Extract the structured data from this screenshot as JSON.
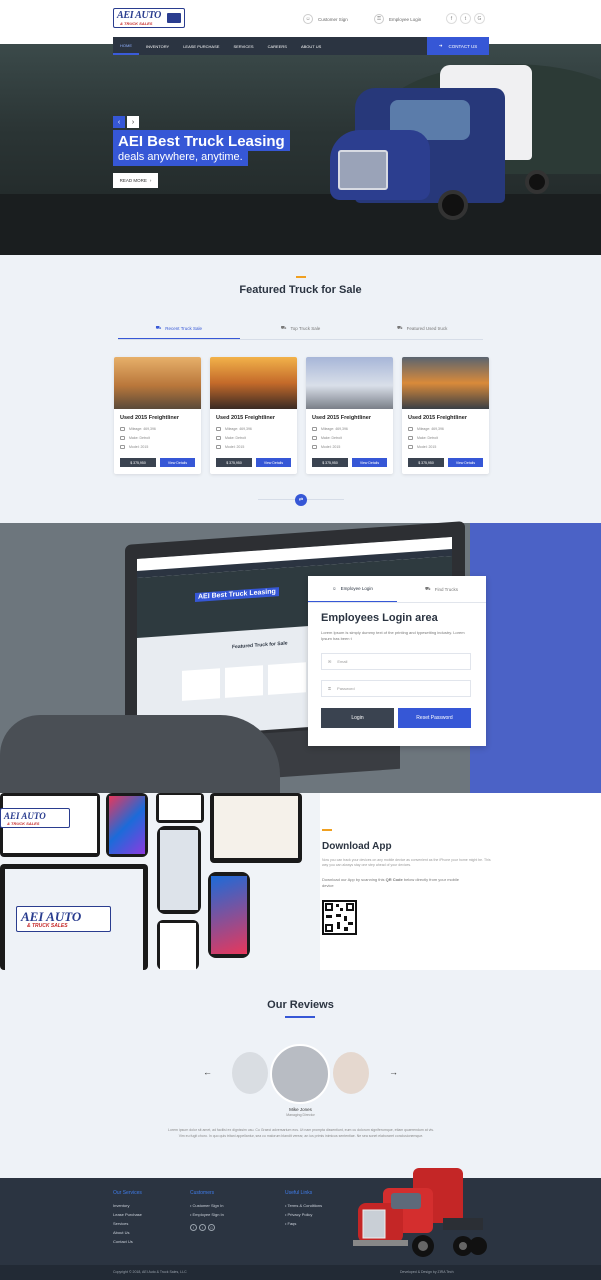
{
  "header": {
    "brand_line1": "AEI AUTO",
    "brand_line2": "& TRUCK SALES",
    "customer_signin": "Customer Sign",
    "employee_login": "Employee Login",
    "social": [
      "f",
      "t",
      "G"
    ]
  },
  "nav": {
    "items": [
      "HOME",
      "INVENTORY",
      "LEASE PURCHASE",
      "SERVICES",
      "CAREERS",
      "ABOUT US"
    ],
    "contact": "CONTACT US"
  },
  "hero": {
    "title": "AEI Best Truck Leasing",
    "subtitle": "deals anywhere, anytime.",
    "cta": "READ MORE"
  },
  "featured": {
    "title": "Featured Truck for Sale",
    "tabs": [
      "Recent Truck Sale",
      "Top Truck Sale",
      "Featured Used truck"
    ],
    "cards": [
      {
        "title": "Used 2015 Freightliner",
        "mileage": "Mileage: 469,396",
        "make": "Make: Detroit",
        "model": "Model: 2015",
        "price": "$ 375,950",
        "cta": "View Details"
      },
      {
        "title": "Used 2015 Freightliner",
        "mileage": "Mileage: 469,396",
        "make": "Make: Detroit",
        "model": "Model: 2015",
        "price": "$ 375,950",
        "cta": "View Details"
      },
      {
        "title": "Used 2015 Freightliner",
        "mileage": "Mileage: 469,396",
        "make": "Make: Detroit",
        "model": "Model: 2015",
        "price": "$ 375,950",
        "cta": "View Details"
      },
      {
        "title": "Used 2015 Freightliner",
        "mileage": "Mileage: 469,396",
        "make": "Make: Detroit",
        "model": "Model: 2015",
        "price": "$ 375,950",
        "cta": "View Details"
      }
    ]
  },
  "login": {
    "tabs": [
      "Employee Login",
      "Find Trucks"
    ],
    "heading": "Employees Login area",
    "text": "Lorem Ipsum is simply dummy text of the printing and typesetting industry. Lorem Ipsum has been t",
    "email_placeholder": "Email",
    "password_placeholder": "Password",
    "login_btn": "Login",
    "reset_btn": "Reset Password",
    "laptop_screen_title": "AEI Best Truck Leasing",
    "laptop_screen_section": "Featured Truck for Sale"
  },
  "app": {
    "title": "Download App",
    "desc": "Now you can track your devices on any mobile device as convenient as the iPhone your home might be. This way you can always stay one step ahead of your devices.",
    "qr_text_prefix": "Download our App by scanning this ",
    "qr_text_bold": "QR Code",
    "qr_text_suffix": " below directly from your mobile device"
  },
  "reviews": {
    "title": "Our Reviews",
    "name": "Mike Jones",
    "role": "Managing Director",
    "text": "Lorem ipsum dolor sit amet, ad facilisi ex dignissim usu. Cu Graeci adversarium eos. Ut nam prompta dissentiunt, eum cu dolorum signiferumque, etiam quaerendum at vis. Vim eu fugit choro. In quo quis tritani appellantur, sea cu malorum blandit verear, an ius primis inimicus sententiae. Ne sea sonet elaboraret conclusionemque."
  },
  "footer": {
    "col1_head": "Our Services",
    "col1_items": [
      "Inventory",
      "Lease Purchase",
      "Services",
      "About Us",
      "Contact Us"
    ],
    "col2_head": "Customers",
    "col2_items": [
      "Customer Sign In",
      "Employee Sign In"
    ],
    "col3_head": "Useful Links",
    "col3_items": [
      "Terms & Conditions",
      "Privacy Policy",
      "Faqs"
    ],
    "copyright": "Copyright © 2018, AEI Auto & Truck Sales, LLC",
    "developer": "Developed & Design by  ZIRA Tech"
  },
  "colors": {
    "brand_blue": "#3657d6",
    "dark_nav": "#2b3441",
    "accent_orange": "#f0a020"
  }
}
